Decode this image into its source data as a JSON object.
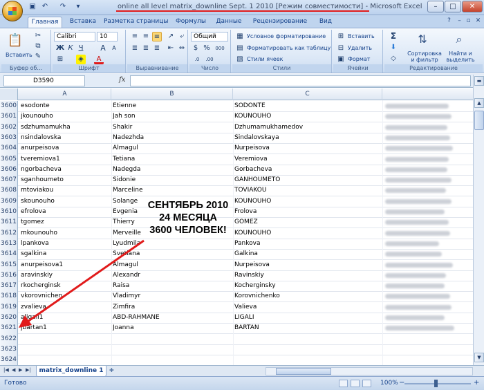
{
  "window": {
    "title": "online all level matrix_downline Sept. 1 2010  [Режим совместимости] - Microsoft Excel",
    "minimize": "–",
    "maximize": "□",
    "close": "✕"
  },
  "ribbon_tabs": [
    "Главная",
    "Вставка",
    "Разметка страницы",
    "Формулы",
    "Данные",
    "Рецензирование",
    "Вид"
  ],
  "ribbon": {
    "clipboard": {
      "paste": "Вставить",
      "label": "Буфер об..."
    },
    "font": {
      "name": "Calibri",
      "size": "10",
      "label": "Шрифт",
      "bold": "Ж",
      "italic": "К",
      "underline": "Ч",
      "grow": "A",
      "shrink": "A"
    },
    "alignment": {
      "label": "Выравнивание"
    },
    "number": {
      "format": "Общий",
      "label": "Число",
      "percent": "%",
      "thousands": "000"
    },
    "styles": {
      "conditional": "Условное форматирование",
      "as_table": "Форматировать как таблицу",
      "cell_styles": "Стили ячеек",
      "label": "Стили"
    },
    "cells": {
      "insert": "Вставить",
      "delete": "Удалить",
      "format": "Формат",
      "label": "Ячейки"
    },
    "editing": {
      "sum": "Σ",
      "sort": "Сортировка и фильтр",
      "find": "Найти и выделить",
      "label": "Редактирование"
    }
  },
  "formula_bar": {
    "name_box": "D3590",
    "fx": "fx",
    "value": ""
  },
  "columns": [
    "A",
    "B",
    "C"
  ],
  "rows": [
    {
      "n": "3600",
      "a": "esodonte",
      "b": "Etienne",
      "c": "SODONTE",
      "email": true
    },
    {
      "n": "3601",
      "a": "jkounouho",
      "b": "Jah son",
      "c": "KOUNOUHO",
      "email": true
    },
    {
      "n": "3602",
      "a": "sdzhumamukha",
      "b": "Shakir",
      "c": "Dzhumamukhamedov",
      "email": true
    },
    {
      "n": "3603",
      "a": "nsindalovska",
      "b": "Nadezhda",
      "c": "Sindalovskaya",
      "email": true
    },
    {
      "n": "3604",
      "a": "anurpeisova",
      "b": "Almagul",
      "c": "Nurpeisova",
      "email": true
    },
    {
      "n": "3605",
      "a": "tveremiova1",
      "b": "Tetiana",
      "c": "Veremiova",
      "email": true
    },
    {
      "n": "3606",
      "a": "ngorbacheva",
      "b": "Nadegda",
      "c": "Gorbacheva",
      "email": true
    },
    {
      "n": "3607",
      "a": "sganhoumeto",
      "b": "Sidonie",
      "c": "GANHOUMETO",
      "email": true
    },
    {
      "n": "3608",
      "a": "mtoviakou",
      "b": "Marceline",
      "c": "TOVIAKOU",
      "email": true
    },
    {
      "n": "3609",
      "a": "skounouho",
      "b": "Solange",
      "c": "KOUNOUHO",
      "email": true
    },
    {
      "n": "3610",
      "a": "efrolova",
      "b": "Evgenia",
      "c": "Frolova",
      "email": true
    },
    {
      "n": "3611",
      "a": "tgomez",
      "b": "Thierry",
      "c": "GOMEZ",
      "email": true
    },
    {
      "n": "3612",
      "a": "mkounouho",
      "b": "Merveille",
      "c": "KOUNOUHO",
      "email": true
    },
    {
      "n": "3613",
      "a": "lpankova",
      "b": "Lyudmila",
      "c": "Pankova",
      "email": true
    },
    {
      "n": "3614",
      "a": "sgalkina",
      "b": "Svetlana",
      "c": "Galkina",
      "email": true
    },
    {
      "n": "3615",
      "a": "anurpeisova1",
      "b": "Almagul",
      "c": "Nurpeisova",
      "email": true
    },
    {
      "n": "3616",
      "a": "aravinskiy",
      "b": "Alexandr",
      "c": "Ravinskiy",
      "email": true
    },
    {
      "n": "3617",
      "a": "rkocherginsk",
      "b": "Raisa",
      "c": "Kocherginsky",
      "email": true
    },
    {
      "n": "3618",
      "a": "vkorovnichen",
      "b": "Vladimyr",
      "c": "Korovnichenko",
      "email": true
    },
    {
      "n": "3619",
      "a": "zvalieva",
      "b": "Zimfira",
      "c": "Valieva",
      "email": true
    },
    {
      "n": "3620",
      "a": "aligali1",
      "b": "ABD-RAHMANE",
      "c": "LIGALI",
      "email": true
    },
    {
      "n": "3621",
      "a": "jbartan1",
      "b": "Joanna",
      "c": "BARTAN",
      "email": true
    },
    {
      "n": "3622",
      "a": "",
      "b": "",
      "c": "",
      "email": false
    },
    {
      "n": "3623",
      "a": "",
      "b": "",
      "c": "",
      "email": false
    },
    {
      "n": "3624",
      "a": "",
      "b": "",
      "c": "",
      "email": false
    }
  ],
  "annotation": {
    "line1": "СЕНТЯБРЬ 2010",
    "line2": "24 МЕСЯЦА",
    "line3": "3600 ЧЕЛОВЕК!",
    "arrow_color": "#e11b1b"
  },
  "sheet_tab": "matrix_downline 1",
  "status": {
    "ready": "Готово",
    "zoom": "100%",
    "minus": "−",
    "plus": "+"
  }
}
